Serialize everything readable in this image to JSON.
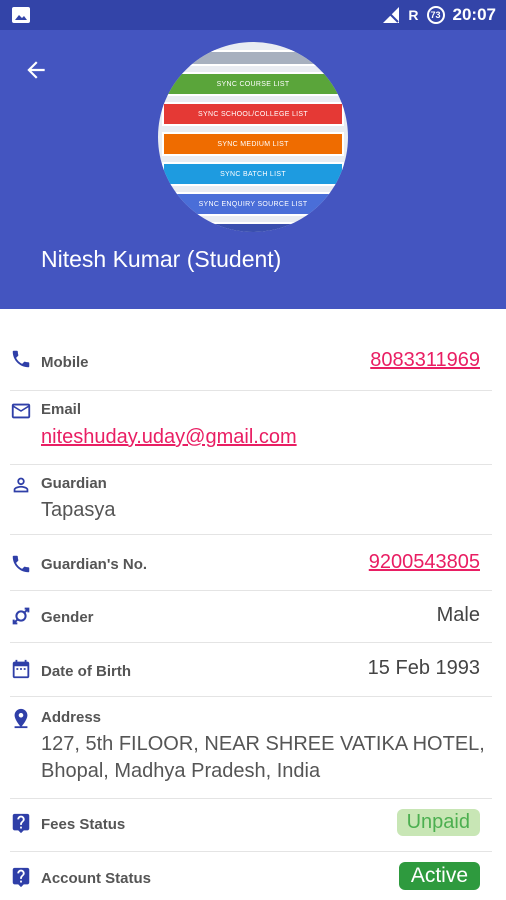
{
  "status_bar": {
    "network_label": "R",
    "badge": "73",
    "time": "20:07"
  },
  "header": {
    "back_icon": "arrow-back-icon",
    "avatar_items": [
      "SYNC COURSE LIST",
      "SYNC SCHOOL/COLLEGE LIST",
      "SYNC MEDIUM LIST",
      "SYNC BATCH LIST",
      "SYNC ENQUIRY SOURCE LIST"
    ],
    "name": "Nitesh Kumar (Student)",
    "bg_color": "#4455c0"
  },
  "details": {
    "mobile": {
      "label": "Mobile",
      "value": "8083311969",
      "icon": "phone-icon"
    },
    "email": {
      "label": "Email",
      "value": "niteshuday.uday@gmail.com",
      "icon": "mail-icon"
    },
    "guardian": {
      "label": "Guardian",
      "value": "Tapasya",
      "icon": "person-icon"
    },
    "guardian_no": {
      "label": "Guardian's No.",
      "value": "9200543805",
      "icon": "phone-icon"
    },
    "gender": {
      "label": "Gender",
      "value": "Male",
      "icon": "gender-icon"
    },
    "dob": {
      "label": "Date of Birth",
      "value": "15 Feb 1993",
      "icon": "calendar-icon"
    },
    "address": {
      "label": "Address",
      "line1": "127, 5th FILOOR, NEAR SHREE VATIKA HOTEL,",
      "line2": "Bhopal, Madhya Pradesh, India",
      "icon": "location-pin-icon"
    },
    "fees_status": {
      "label": "Fees Status",
      "value": "Unpaid",
      "icon": "help-icon"
    },
    "account_status": {
      "label": "Account Status",
      "value": "Active",
      "icon": "help-icon"
    }
  },
  "colors": {
    "primary": "#4455c0",
    "link": "#e91e63",
    "icon": "#2f3fa8",
    "active": "#2e9a3e",
    "unpaid_bg": "#c8e6b5"
  }
}
